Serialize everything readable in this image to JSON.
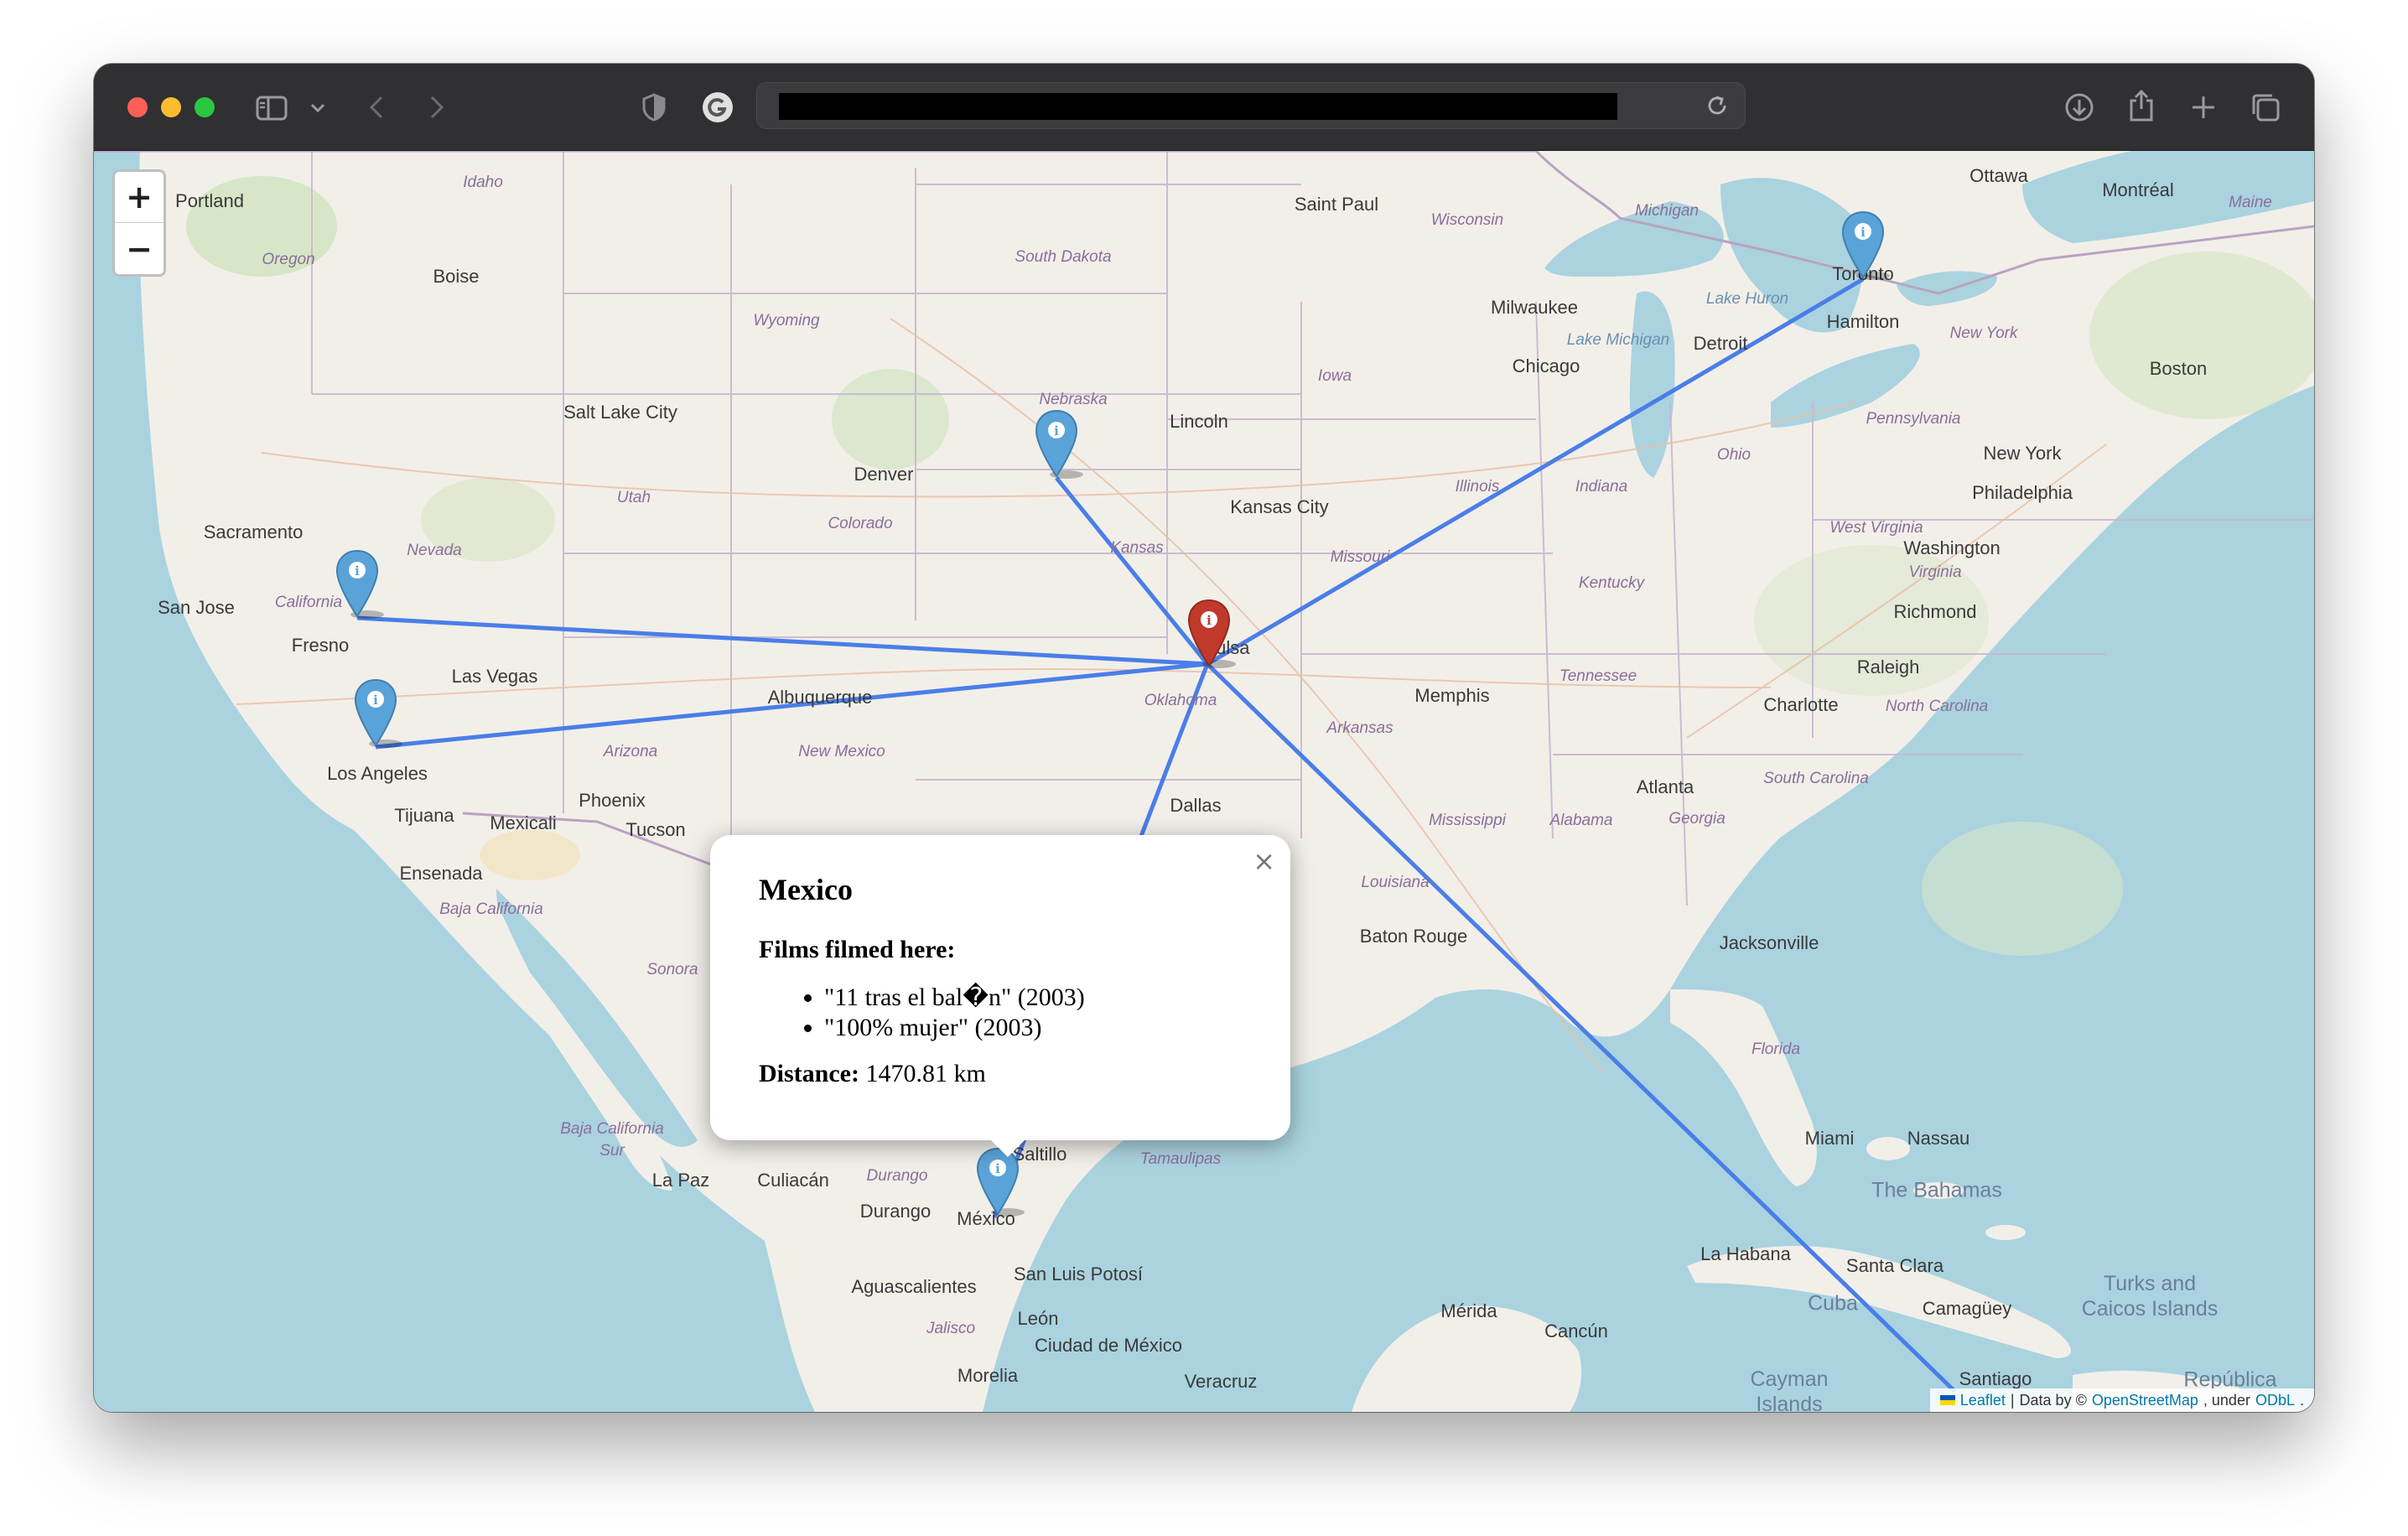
{
  "browser": {
    "address_bar": "",
    "icons": [
      "sidebar-icon",
      "chevron-down-icon",
      "back-icon",
      "forward-icon",
      "shield-icon",
      "grammarly-icon",
      "reload-icon",
      "download-icon",
      "share-icon",
      "new-tab-icon",
      "tabs-overview-icon"
    ]
  },
  "map": {
    "zoom_in_label": "+",
    "zoom_out_label": "−",
    "line_color": "#4a7ee8",
    "marker_color": "#5aa3d9",
    "home_marker_color": "#c0392b",
    "cities": [
      {
        "name": "Portland"
      },
      {
        "name": "Boise"
      },
      {
        "name": "Salt Lake City"
      },
      {
        "name": "Sacramento"
      },
      {
        "name": "San Jose"
      },
      {
        "name": "Fresno"
      },
      {
        "name": "Las Vegas"
      },
      {
        "name": "Los Angeles"
      },
      {
        "name": "Tijuana"
      },
      {
        "name": "Mexicali"
      },
      {
        "name": "Phoenix"
      },
      {
        "name": "Tucson"
      },
      {
        "name": "Ensenada"
      },
      {
        "name": "Denver"
      },
      {
        "name": "Albuquerque"
      },
      {
        "name": "Lincoln"
      },
      {
        "name": "Kansas City"
      },
      {
        "name": "Saint Paul"
      },
      {
        "name": "Milwaukee"
      },
      {
        "name": "Chicago"
      },
      {
        "name": "Detroit"
      },
      {
        "name": "Toronto"
      },
      {
        "name": "Hamilton"
      },
      {
        "name": "Ottawa"
      },
      {
        "name": "Montréal"
      },
      {
        "name": "Boston"
      },
      {
        "name": "New York"
      },
      {
        "name": "Philadelphia"
      },
      {
        "name": "Washington"
      },
      {
        "name": "Richmond"
      },
      {
        "name": "Raleigh"
      },
      {
        "name": "Charlotte"
      },
      {
        "name": "Memphis"
      },
      {
        "name": "Atlanta"
      },
      {
        "name": "Dallas"
      },
      {
        "name": "Tulsa"
      },
      {
        "name": "Baton Rouge"
      },
      {
        "name": "Jacksonville"
      },
      {
        "name": "Miami"
      },
      {
        "name": "Nassau"
      },
      {
        "name": "La Habana"
      },
      {
        "name": "Santa Clara"
      },
      {
        "name": "Camagüey"
      },
      {
        "name": "Santiago"
      },
      {
        "name": "Mérida"
      },
      {
        "name": "Cancún"
      },
      {
        "name": "La Paz"
      },
      {
        "name": "Culiacán"
      },
      {
        "name": "Durango"
      },
      {
        "name": "Saltillo"
      },
      {
        "name": "México"
      },
      {
        "name": "San Luis Potosí"
      },
      {
        "name": "Aguascalientes"
      },
      {
        "name": "León"
      },
      {
        "name": "Ciudad de México"
      },
      {
        "name": "Morelia"
      },
      {
        "name": "Veracruz"
      }
    ],
    "regions": [
      {
        "name": "Idaho"
      },
      {
        "name": "Oregon"
      },
      {
        "name": "Wyoming"
      },
      {
        "name": "South Dakota"
      },
      {
        "name": "Nebraska"
      },
      {
        "name": "Iowa"
      },
      {
        "name": "Wisconsin"
      },
      {
        "name": "Michigan"
      },
      {
        "name": "Nevada"
      },
      {
        "name": "Utah"
      },
      {
        "name": "Colorado"
      },
      {
        "name": "Kansas"
      },
      {
        "name": "Missouri"
      },
      {
        "name": "Illinois"
      },
      {
        "name": "Indiana"
      },
      {
        "name": "Ohio"
      },
      {
        "name": "Pennsylvania"
      },
      {
        "name": "New York"
      },
      {
        "name": "Maine"
      },
      {
        "name": "West Virginia"
      },
      {
        "name": "Virginia"
      },
      {
        "name": "Kentucky"
      },
      {
        "name": "Tennessee"
      },
      {
        "name": "North Carolina"
      },
      {
        "name": "South Carolina"
      },
      {
        "name": "California"
      },
      {
        "name": "Arizona"
      },
      {
        "name": "New Mexico"
      },
      {
        "name": "Oklahoma"
      },
      {
        "name": "Arkansas"
      },
      {
        "name": "Mississippi"
      },
      {
        "name": "Alabama"
      },
      {
        "name": "Georgia"
      },
      {
        "name": "Louisiana"
      },
      {
        "name": "Florida"
      },
      {
        "name": "Baja California"
      },
      {
        "name": "Sonora"
      },
      {
        "name": "Baja California Sur"
      },
      {
        "name": "Durango"
      },
      {
        "name": "Tamaulipas"
      },
      {
        "name": "Jalisco"
      }
    ],
    "water": [
      {
        "name": "Lake Michigan"
      },
      {
        "name": "Lake Huron"
      }
    ],
    "countries": [
      {
        "name": "The Bahamas"
      },
      {
        "name": "Cuba"
      },
      {
        "name": "Turks and Caicos Islands"
      },
      {
        "name": "Cayman Islands"
      },
      {
        "name": "República"
      }
    ]
  },
  "popup": {
    "title": "Mexico",
    "films_heading": "Films filmed here:",
    "films": [
      "\"11 tras el bal�n\" (2003)",
      "\"100% mujer\" (2003)"
    ],
    "distance_label": "Distance:",
    "distance_value": "1470.81 km",
    "close_label": "×"
  },
  "attribution": {
    "leaflet": "Leaflet",
    "separator": "|",
    "data_by": "Data by ©",
    "osm": "OpenStreetMap",
    "under": ", under",
    "license": "ODbL",
    "end": "."
  }
}
